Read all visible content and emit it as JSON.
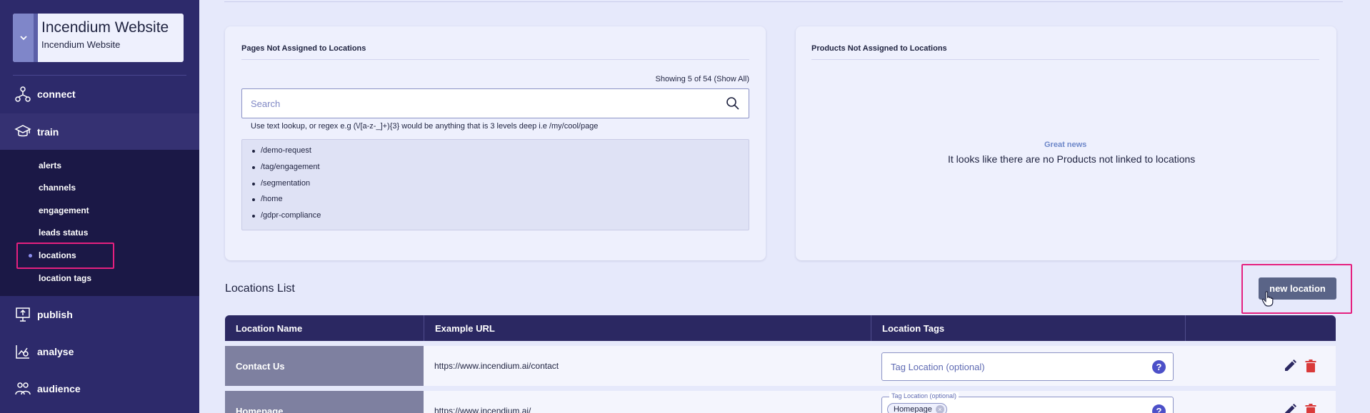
{
  "site": {
    "title": "Incendium Website",
    "subtitle": "Incendium Website"
  },
  "nav": {
    "items": [
      {
        "label": "connect",
        "icon": "connect-icon"
      },
      {
        "label": "train",
        "icon": "train-icon"
      },
      {
        "label": "publish",
        "icon": "publish-icon"
      },
      {
        "label": "analyse",
        "icon": "analyse-icon"
      },
      {
        "label": "audience",
        "icon": "audience-icon"
      }
    ],
    "train_sub": [
      "alerts",
      "channels",
      "engagement",
      "leads status",
      "locations",
      "location tags"
    ],
    "active_sub": "locations"
  },
  "pages_card": {
    "title": "Pages Not Assigned to Locations",
    "showing": "Showing 5 of 54 (Show All)",
    "search_placeholder": "Search",
    "hint": "Use text lookup, or regex e.g (\\/[a-z-_]+){3} would be anything that is 3 levels deep i.e /my/cool/page",
    "pages": [
      "/demo-request",
      "/tag/engagement",
      "/segmentation",
      "/home",
      "/gdpr-compliance"
    ]
  },
  "products_card": {
    "title": "Products Not Assigned to Locations",
    "heading": "Great news",
    "message": "It looks like there are no Products not linked to locations"
  },
  "locations": {
    "title": "Locations List",
    "new_button": "new location",
    "columns": [
      "Location Name",
      "Example URL",
      "Location Tags",
      ""
    ],
    "tag_placeholder": "Tag Location (optional)",
    "rows": [
      {
        "name": "Contact Us",
        "url": "https://www.incendium.ai/contact",
        "tags": []
      },
      {
        "name": "Homepage",
        "url": "https://www.incendium.ai/",
        "tags": [
          "Homepage"
        ]
      }
    ]
  },
  "colors": {
    "sidebar": "#2d2a6b",
    "subnav": "#1b1846",
    "highlight": "#e5207f",
    "table_header": "#2b2862",
    "delete": "#d93a3a"
  }
}
